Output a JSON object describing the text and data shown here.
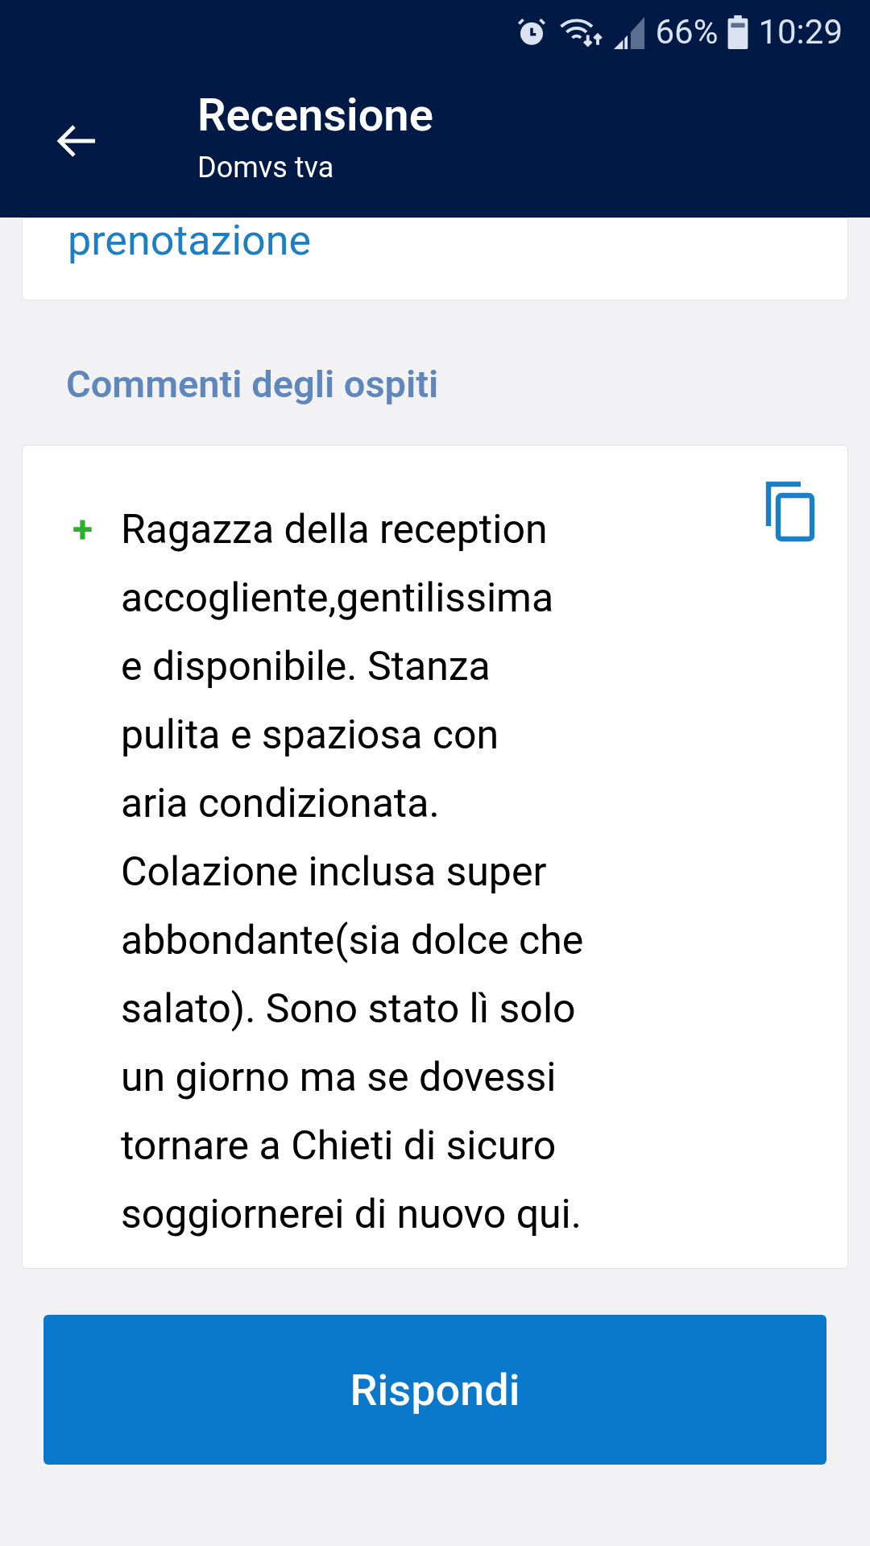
{
  "status_bar": {
    "battery": "66%",
    "time": "10:29"
  },
  "header": {
    "title": "Recensione",
    "subtitle": "Domvs tva"
  },
  "top_card": {
    "link": "prenotazione"
  },
  "comments": {
    "title": "Commenti degli ospiti",
    "items": [
      {
        "kind": "positive",
        "marker": "+",
        "text": "Ragazza della reception\naccogliente,gentilissima\ne disponibile. Stanza\npulita e spaziosa con\naria condizionata.\nColazione inclusa super\nabbondante(sia dolce che\nsalato). Sono stato lì solo\nun giorno ma se dovessi\ntornare a Chieti di sicuro\nsoggiornerei di nuovo qui."
      }
    ]
  },
  "reply_button": {
    "label": "Rispondi"
  }
}
